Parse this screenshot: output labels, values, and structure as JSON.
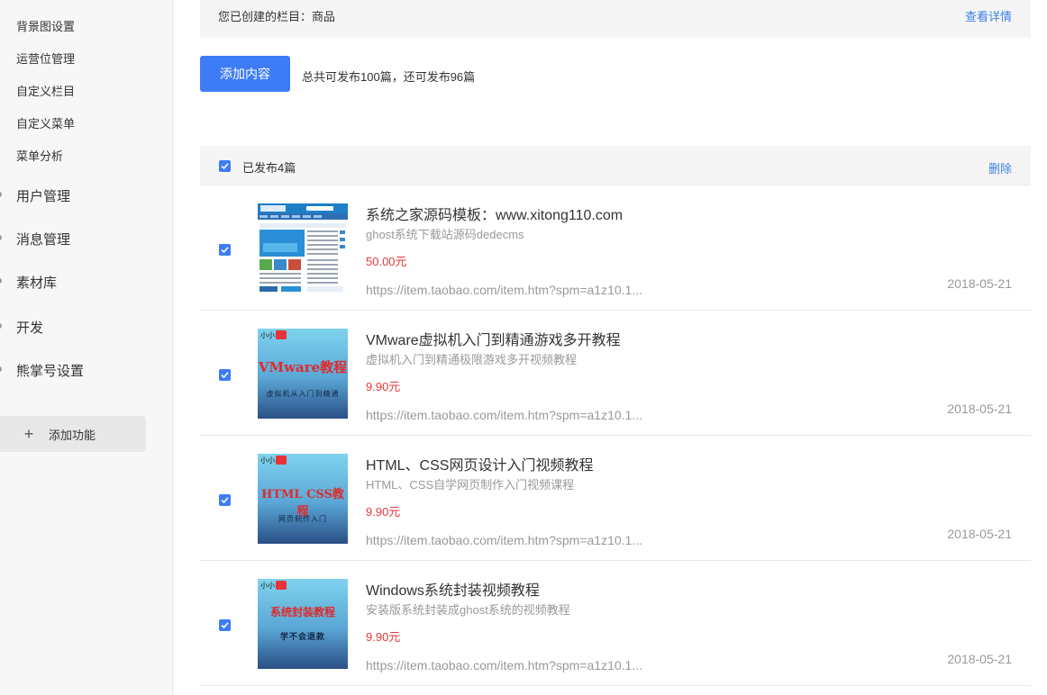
{
  "sidebar": {
    "sub_items": [
      "背景图设置",
      "运营位管理",
      "自定义栏目",
      "自定义菜单",
      "菜单分析"
    ],
    "sections": [
      "用户管理",
      "消息管理",
      "素材库",
      "开发",
      "熊掌号设置"
    ],
    "add_function": "添加功能"
  },
  "info_bar": {
    "text": "您已创建的栏目：商品",
    "link": "查看详情"
  },
  "toolbar": {
    "add_button": "添加内容",
    "quota": "总共可发布100篇，还可发布96篇"
  },
  "list": {
    "header": "已发布4篇",
    "delete": "删除",
    "items": [
      {
        "title": "系统之家源码模板：www.xitong110.com",
        "subtitle": "ghost系统下载站源码dedecms",
        "price": "50.00元",
        "url": "https://item.taobao.com/item.htm?spm=a1z10.1...",
        "date": "2018-05-21"
      },
      {
        "title": "VMware虚拟机入门到精通游戏多开教程",
        "subtitle": "虚拟机入门到精通极限游戏多开视频教程",
        "price": "9.90元",
        "url": "https://item.taobao.com/item.htm?spm=a1z10.1...",
        "date": "2018-05-21",
        "cover": {
          "brand": "小小",
          "title": "VMware教程",
          "sub": "虚拟机从入门到精通"
        }
      },
      {
        "title": "HTML、CSS网页设计入门视频教程",
        "subtitle": "HTML、CSS自学网页制作入门视频课程",
        "price": "9.90元",
        "url": "https://item.taobao.com/item.htm?spm=a1z10.1...",
        "date": "2018-05-21",
        "cover": {
          "brand": "小小",
          "title": "HTML CSS教程",
          "sub": "网页制作入门"
        }
      },
      {
        "title": "Windows系统封装视频教程",
        "subtitle": "安装版系统封装成ghost系统的视频教程",
        "price": "9.90元",
        "url": "https://item.taobao.com/item.htm?spm=a1z10.1...",
        "date": "2018-05-21",
        "cover": {
          "brand": "小小",
          "title": "系统封装教程",
          "sub": "学不会退款"
        }
      }
    ]
  }
}
